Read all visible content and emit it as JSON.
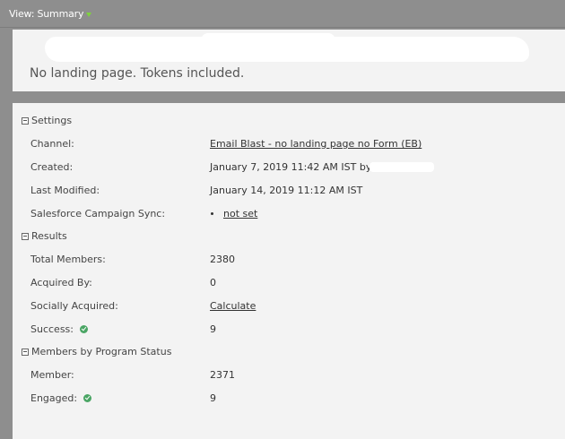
{
  "toolbar": {
    "view_label": "View: Summary"
  },
  "header": {
    "description": "No landing page. Tokens included."
  },
  "sections": {
    "settings": {
      "title": "Settings",
      "rows": {
        "channel": {
          "label": "Channel:",
          "value": "Email Blast - no landing page no Form (EB)"
        },
        "created": {
          "label": "Created:",
          "value": "January 7, 2019 11:42 AM IST by"
        },
        "last_modified": {
          "label": "Last Modified:",
          "value": "January 14, 2019 11:12 AM IST"
        },
        "sfdc_sync": {
          "label": "Salesforce Campaign Sync:",
          "value": "not set"
        }
      }
    },
    "results": {
      "title": "Results",
      "rows": {
        "total_members": {
          "label": "Total Members:",
          "value": "2380"
        },
        "acquired_by": {
          "label": "Acquired By:",
          "value": "0"
        },
        "socially_acquired": {
          "label": "Socially Acquired:",
          "value": "Calculate"
        },
        "success": {
          "label": "Success:",
          "value": "9"
        }
      }
    },
    "members_by_status": {
      "title": "Members by Program Status",
      "rows": {
        "member": {
          "label": "Member:",
          "value": "2371"
        },
        "engaged": {
          "label": "Engaged:",
          "value": "9"
        }
      }
    }
  },
  "colors": {
    "frame_gray": "#8e8e8e",
    "panel_bg": "#f3f3f3",
    "success_green": "#4aa564",
    "caret_green": "#7fd23e"
  }
}
